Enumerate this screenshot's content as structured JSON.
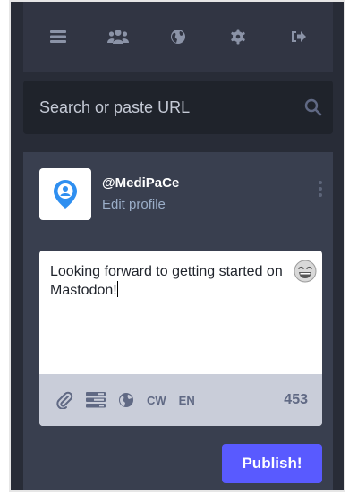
{
  "nav": {
    "items": [
      {
        "icon": "menu-icon"
      },
      {
        "icon": "users-icon"
      },
      {
        "icon": "globe-icon"
      },
      {
        "icon": "gear-icon"
      },
      {
        "icon": "logout-icon"
      }
    ]
  },
  "search": {
    "placeholder": "Search or paste URL"
  },
  "profile": {
    "handle": "@MediPaCe",
    "edit_label": "Edit profile"
  },
  "composer": {
    "text": "Looking forward to getting started on Mastodon!",
    "toolbar": {
      "cw_label": "CW",
      "lang_label": "EN",
      "char_count": "453"
    },
    "publish_label": "Publish!"
  },
  "colors": {
    "background": "#282c37",
    "panel": "#393f4f",
    "accent": "#595aff",
    "icon_muted": "#8b93a7"
  }
}
